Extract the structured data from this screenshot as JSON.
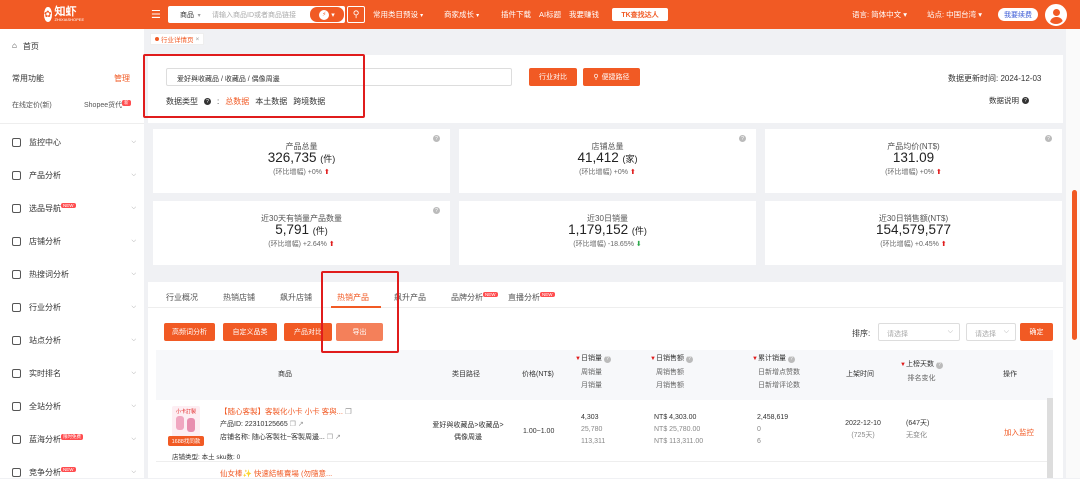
{
  "app": {
    "logo_text": "知虾",
    "logo_sub": "ZHIXIASHOPEE"
  },
  "search": {
    "type": "商品",
    "placeholder": "请输入商品ID或者商品链接",
    "bolt": "⚡"
  },
  "topnav": [
    {
      "label": "常用类目预设",
      "dropdown": true
    },
    {
      "label": "商家成长",
      "dropdown": true
    },
    {
      "label": "插件下载",
      "dropdown": false
    },
    {
      "label": "AI标题",
      "dropdown": false
    },
    {
      "label": "我要赚钱",
      "dropdown": false
    }
  ],
  "tk_button": "TK查找达人",
  "language": "语言: 简体中文",
  "site": "站点: 中国台湾",
  "renew": "我要续费",
  "sidebar": {
    "home": "首页",
    "common": "常用功能",
    "manage": "管理",
    "sub1": "在线定价(新)",
    "sub2": "Shopee货代",
    "sub2_badge": "新",
    "items": [
      {
        "label": "监控中心",
        "badge": ""
      },
      {
        "label": "产品分析",
        "badge": ""
      },
      {
        "label": "选品导航",
        "badge": "NEW"
      },
      {
        "label": "店铺分析",
        "badge": ""
      },
      {
        "label": "热搜词分析",
        "badge": ""
      },
      {
        "label": "行业分析",
        "badge": ""
      },
      {
        "label": "站点分析",
        "badge": ""
      },
      {
        "label": "实时排名",
        "badge": ""
      },
      {
        "label": "全站分析",
        "badge": ""
      },
      {
        "label": "蓝海分析",
        "badge": "限时免费"
      },
      {
        "label": "竞争分析",
        "badge": "NEW"
      }
    ]
  },
  "breadcrumb": "行业详情页",
  "filter": {
    "category_path": "爱好與收藏品 / 收藏品 / 偶像周邊",
    "compare_btn": "行业对比",
    "portal_btn": "便捷路径",
    "data_type_label": "数据类型",
    "data_types": [
      "总数据",
      "本土数据",
      "跨境数据"
    ],
    "update_time": "数据更新时间:   2024-12-03",
    "explain": "数据说明"
  },
  "stats": [
    {
      "title": "产品总量",
      "value": "326,735",
      "unit": "(件)",
      "change_label": "(环比增幅)",
      "change": "+0%",
      "dir": "up"
    },
    {
      "title": "店铺总量",
      "value": "41,412",
      "unit": "(家)",
      "change_label": "(环比增幅)",
      "change": "+0%",
      "dir": "up"
    },
    {
      "title": "产品均价(NT$)",
      "value": "131.09",
      "unit": "",
      "change_label": "(环比增幅)",
      "change": "+0%",
      "dir": "up"
    },
    {
      "title": "近30天有销量产品数量",
      "value": "5,791",
      "unit": "(件)",
      "change_label": "(环比增幅)",
      "change": "+2.64%",
      "dir": "up"
    },
    {
      "title": "近30日销量",
      "value": "1,179,152",
      "unit": "(件)",
      "change_label": "(环比增幅)",
      "change": "-18.65%",
      "dir": "down"
    },
    {
      "title": "近30日销售额(NT$)",
      "value": "154,579,577",
      "unit": "",
      "change_label": "(环比增幅)",
      "change": "+0.45%",
      "dir": "up"
    }
  ],
  "tabs": [
    {
      "label": "行业概况",
      "badge": ""
    },
    {
      "label": "热销店铺",
      "badge": ""
    },
    {
      "label": "飙升店铺",
      "badge": ""
    },
    {
      "label": "热销产品",
      "badge": ""
    },
    {
      "label": "飙升产品",
      "badge": ""
    },
    {
      "label": "品牌分析",
      "badge": "NEW"
    },
    {
      "label": "直播分析",
      "badge": "NEW"
    }
  ],
  "actions": {
    "btn1": "高频词分析",
    "btn2": "自定义品类",
    "btn3": "产品对比",
    "btn4": "导出",
    "sort_label": "排序:",
    "sel1": "请选择",
    "sel2": "请选择",
    "confirm": "确定"
  },
  "table": {
    "headers": {
      "product": "商品",
      "category": "类目路径",
      "price": "价格(NT$)",
      "sales": [
        "日销量",
        "周销量",
        "月销量"
      ],
      "revenue": [
        "日销售额",
        "周销售额",
        "月销售额"
      ],
      "cumulative": [
        "累计销量",
        "日新增点赞数",
        "日新增评论数"
      ],
      "listed": "上架时间",
      "days": [
        "上榜天数",
        "排名变化"
      ],
      "ops": "操作"
    },
    "rows": [
      {
        "title": "【随心客製】客製化小卡 小卡 客與...",
        "thumb_label": "小卡訂製",
        "thumb_tag": "1688找同款",
        "pid": "产品ID: 22310125665",
        "shop": "店铺名称: 随心客製社~客製周邊...",
        "store_type": "店铺类型: 本土  sku数: 0",
        "category": "爱好與收藏品>收藏品>偶像周邊",
        "price": "1.00~1.00",
        "sales": [
          "4,303",
          "25,780",
          "113,311"
        ],
        "revenue": [
          "NT$ 4,303.00",
          "NT$ 25,780.00",
          "NT$ 113,311.00"
        ],
        "cumulative": [
          "2,458,619",
          "0",
          "6"
        ],
        "listed": [
          "2022-12-10",
          "(725天)"
        ],
        "days": [
          "(647天)",
          "无变化"
        ],
        "op": "加入监控"
      }
    ],
    "next_row_title": "仙女棒✨ 快速結帳賣場 (勿隨意..."
  }
}
